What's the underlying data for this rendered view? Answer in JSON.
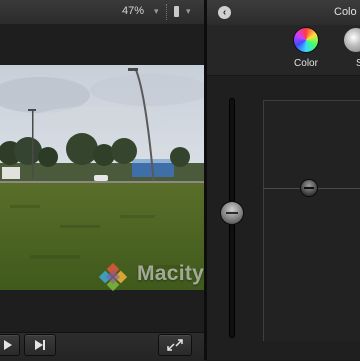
{
  "viewer": {
    "zoom_level": "47%",
    "zoom_chevron_icon": "chevron-down-icon",
    "view_chevron_icon": "chevron-down-icon"
  },
  "inspector": {
    "back_icon": "‹",
    "title": "Colo",
    "tabs": [
      {
        "id": "color",
        "label": "Color",
        "icon": "color-wheel-icon"
      },
      {
        "id": "saturation",
        "label": "S",
        "icon": "saturation-icon"
      }
    ]
  },
  "watermark": {
    "text": "Macitynet.it"
  },
  "colors": {
    "accent_board_bg": "#222222",
    "panel_bg": "#232323"
  }
}
